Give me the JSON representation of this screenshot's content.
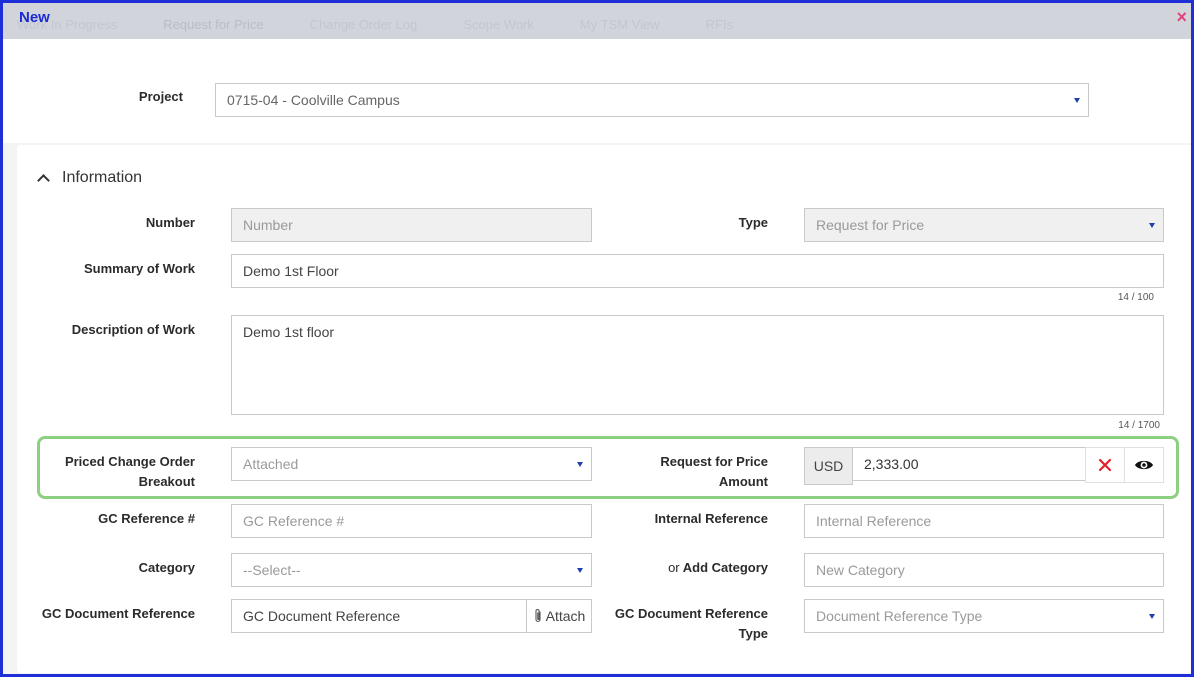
{
  "window": {
    "title": "New",
    "close_icon": "close-icon",
    "background_tabs": [
      "Work In Progress",
      "Request for Price",
      "Change Order Log",
      "Scope Work",
      "My TSM View",
      "RFIs"
    ]
  },
  "project": {
    "label": "Project",
    "value": "0715-04 - Coolville Campus"
  },
  "section": {
    "title": "Information",
    "icon": "chevron-up-icon"
  },
  "fields": {
    "number": {
      "label": "Number",
      "placeholder": "Number"
    },
    "type": {
      "label": "Type",
      "value": "Request for Price"
    },
    "summary": {
      "label": "Summary of Work",
      "value": "Demo 1st Floor",
      "counter": "14 / 100"
    },
    "description": {
      "label": "Description of Work",
      "value": "Demo 1st floor",
      "counter": "14 / 1700"
    },
    "pco_breakout": {
      "label_line1": "Priced Change Order",
      "label_line2": "Breakout",
      "value": "Attached"
    },
    "rfp_amount": {
      "label_line1": "Request for Price",
      "label_line2": "Amount",
      "currency": "USD",
      "value": "2,333.00",
      "clear_icon": "clear-icon",
      "view_icon": "eye-icon"
    },
    "gc_reference": {
      "label": "GC Reference #",
      "placeholder": "GC Reference #"
    },
    "internal_reference": {
      "label": "Internal Reference",
      "placeholder": "Internal Reference"
    },
    "category": {
      "label": "Category",
      "value": "--Select--"
    },
    "add_category": {
      "label_prefix": "or",
      "label": "Add Category",
      "placeholder": "New Category"
    },
    "gc_document_reference": {
      "label": "GC Document Reference",
      "placeholder": "GC Document Reference",
      "attach_label": "Attach",
      "attach_icon": "paperclip-icon"
    },
    "gc_document_reference_type": {
      "label_line1": "GC Document Reference",
      "label_line2": "Type",
      "value": "Document Reference Type"
    }
  },
  "colors": {
    "window_border": "#1f2fd8",
    "title": "#1b2bd3",
    "highlight": "#8ccf80",
    "clear_icon": "#e0202a",
    "caret": "#1f3fb0"
  }
}
